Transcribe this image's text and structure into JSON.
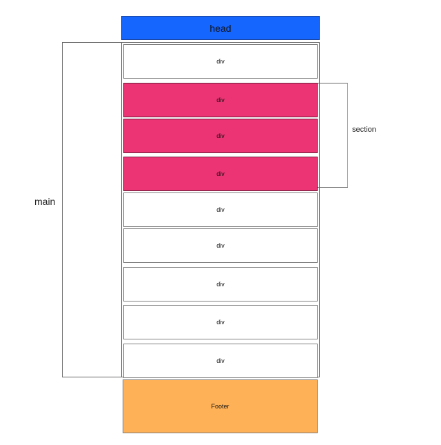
{
  "diagram": {
    "header_label": "head",
    "main_label": "main",
    "section_label": "section",
    "footer_label": "Footer",
    "rows": [
      {
        "label": "div",
        "in_section": false
      },
      {
        "label": "div",
        "in_section": true
      },
      {
        "label": "div",
        "in_section": true
      },
      {
        "label": "div",
        "in_section": true
      },
      {
        "label": "div",
        "in_section": false
      },
      {
        "label": "div",
        "in_section": false
      },
      {
        "label": "div",
        "in_section": false
      },
      {
        "label": "div",
        "in_section": false
      },
      {
        "label": "div",
        "in_section": false
      }
    ],
    "colors": {
      "head": "#1565ff",
      "section": "#ec3373",
      "footer": "#ffb157",
      "row": "#ffffff",
      "line": "#666666"
    }
  }
}
